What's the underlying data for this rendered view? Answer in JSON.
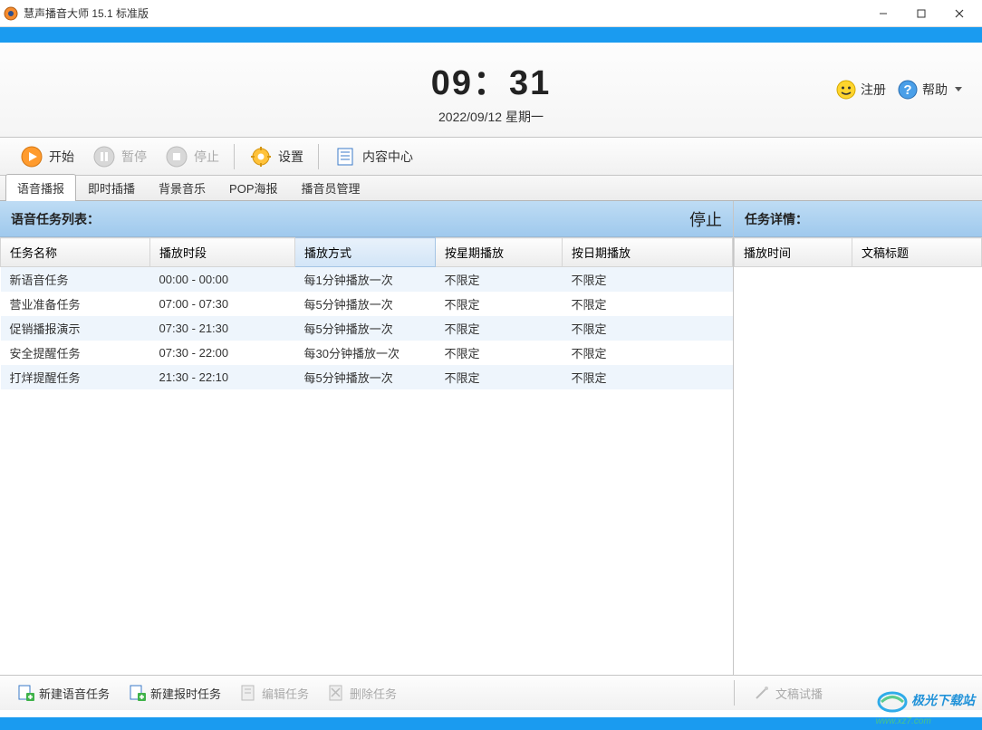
{
  "window": {
    "title": "慧声播音大师 15.1 标准版"
  },
  "clock": {
    "time": "09：31",
    "date": "2022/09/12 星期一"
  },
  "header_buttons": {
    "register": "注册",
    "help": "帮助"
  },
  "toolbar": {
    "start": "开始",
    "pause": "暂停",
    "stop": "停止",
    "settings": "设置",
    "content_center": "内容中心"
  },
  "tabs": [
    {
      "label": "语音播报",
      "active": true
    },
    {
      "label": "即时插播",
      "active": false
    },
    {
      "label": "背景音乐",
      "active": false
    },
    {
      "label": "POP海报",
      "active": false
    },
    {
      "label": "播音员管理",
      "active": false
    }
  ],
  "left_panel": {
    "title": "语音任务列表：",
    "status": "停止",
    "columns": [
      "任务名称",
      "播放时段",
      "播放方式",
      "按星期播放",
      "按日期播放"
    ],
    "selected_col_index": 2,
    "rows": [
      {
        "name": "新语音任务",
        "period": "00:00 - 00:00",
        "mode": "每1分钟播放一次",
        "weekday": "不限定",
        "date": "不限定"
      },
      {
        "name": "营业准备任务",
        "period": "07:00 - 07:30",
        "mode": "每5分钟播放一次",
        "weekday": "不限定",
        "date": "不限定"
      },
      {
        "name": "促销播报演示",
        "period": "07:30 - 21:30",
        "mode": "每5分钟播放一次",
        "weekday": "不限定",
        "date": "不限定"
      },
      {
        "name": "安全提醒任务",
        "period": "07:30 - 22:00",
        "mode": "每30分钟播放一次",
        "weekday": "不限定",
        "date": "不限定"
      },
      {
        "name": "打烊提醒任务",
        "period": "21:30 - 22:10",
        "mode": "每5分钟播放一次",
        "weekday": "不限定",
        "date": "不限定"
      }
    ]
  },
  "right_panel": {
    "title": "任务详情：",
    "columns": [
      "播放时间",
      "文稿标题"
    ]
  },
  "bottom_bar": {
    "new_voice_task": "新建语音任务",
    "new_timed_task": "新建报时任务",
    "edit_task": "编辑任务",
    "delete_task": "删除任务",
    "trial_play": "文稿试播"
  },
  "watermark": {
    "text": "极光下载站",
    "url": "www.xz7.com"
  }
}
